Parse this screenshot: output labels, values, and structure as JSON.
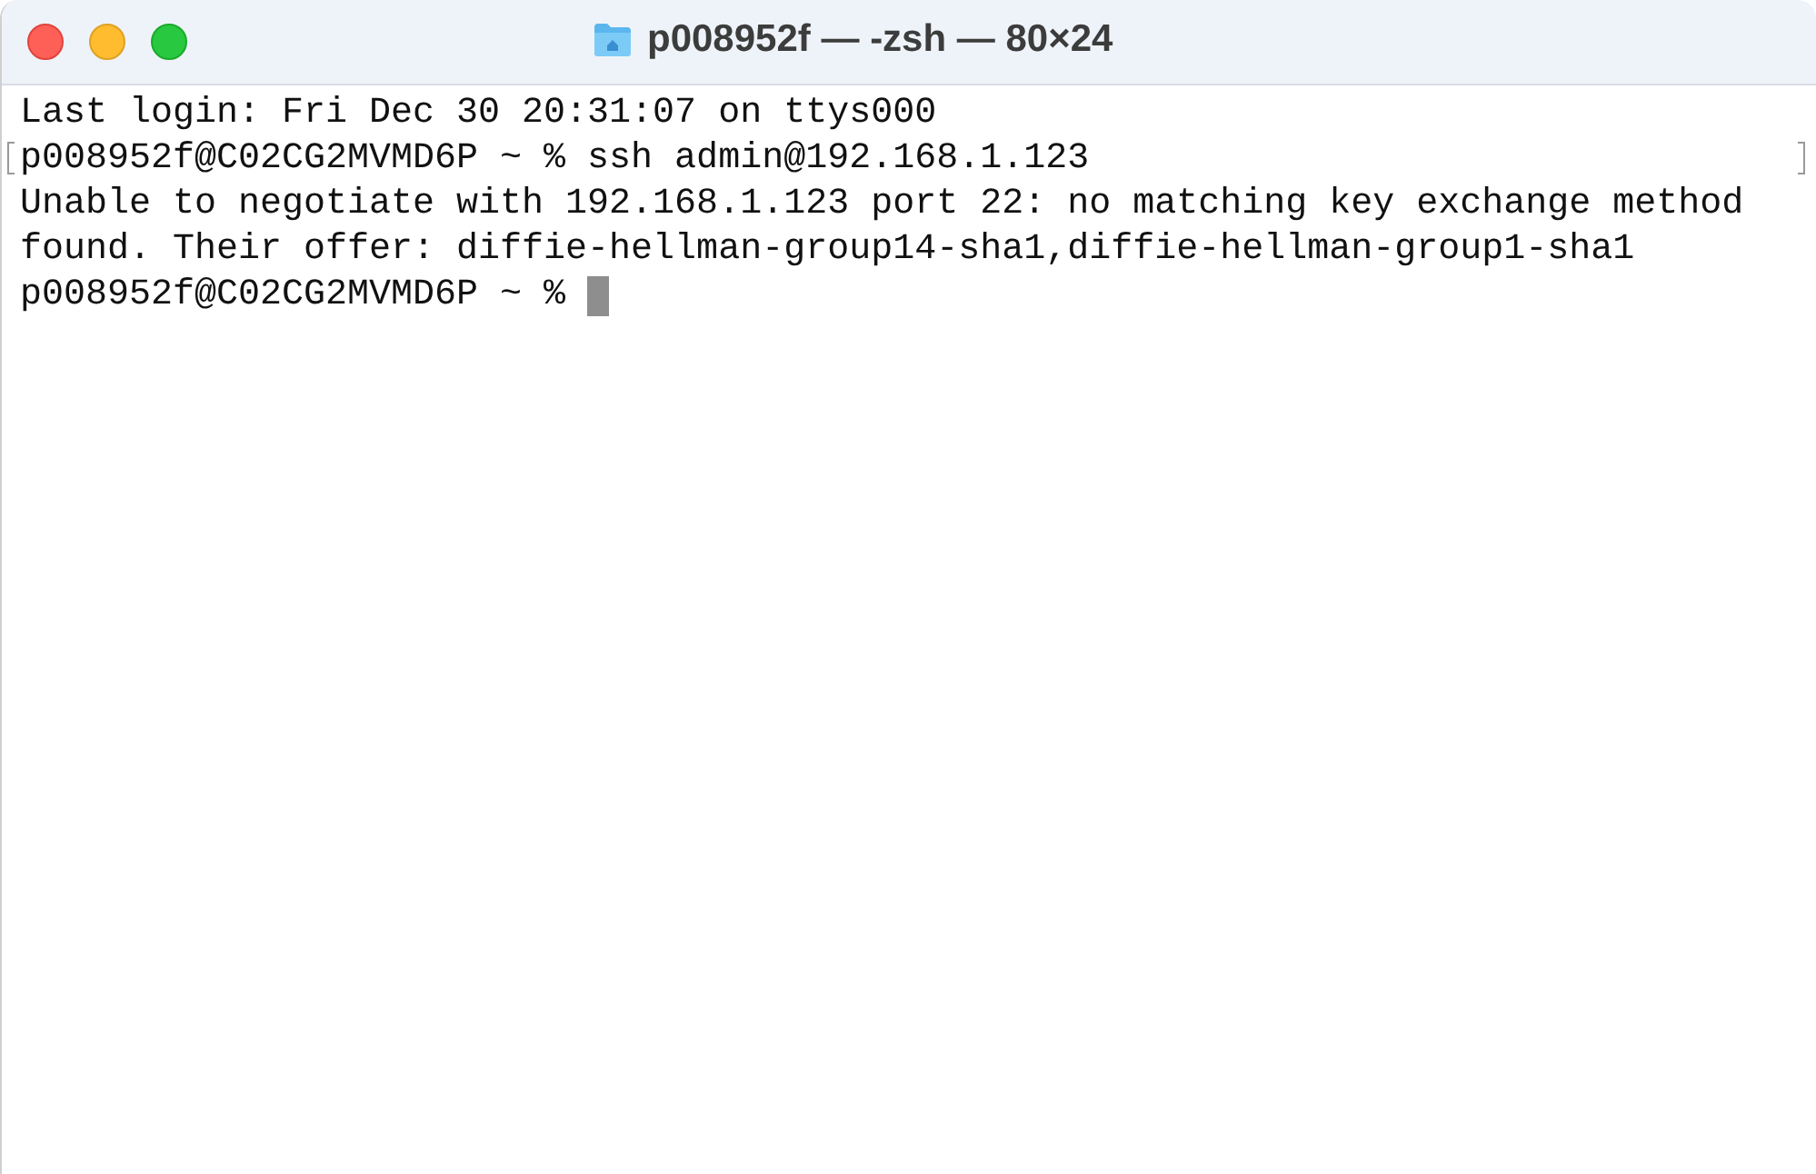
{
  "window": {
    "title": "p008952f — -zsh — 80×24"
  },
  "lines": [
    {
      "text": "Last login: Fri Dec 30 20:31:07 on ttys000",
      "marked": false
    },
    {
      "text": "p008952f@C02CG2MVMD6P ~ % ssh admin@192.168.1.123",
      "marked": true
    },
    {
      "text": "Unable to negotiate with 192.168.1.123 port 22: no matching key exchange method",
      "marked": false
    },
    {
      "text": "found. Their offer: diffie-hellman-group14-sha1,diffie-hellman-group1-sha1",
      "marked": false
    },
    {
      "text": "p008952f@C02CG2MVMD6P ~ % ",
      "marked": false,
      "cursor": true
    }
  ]
}
